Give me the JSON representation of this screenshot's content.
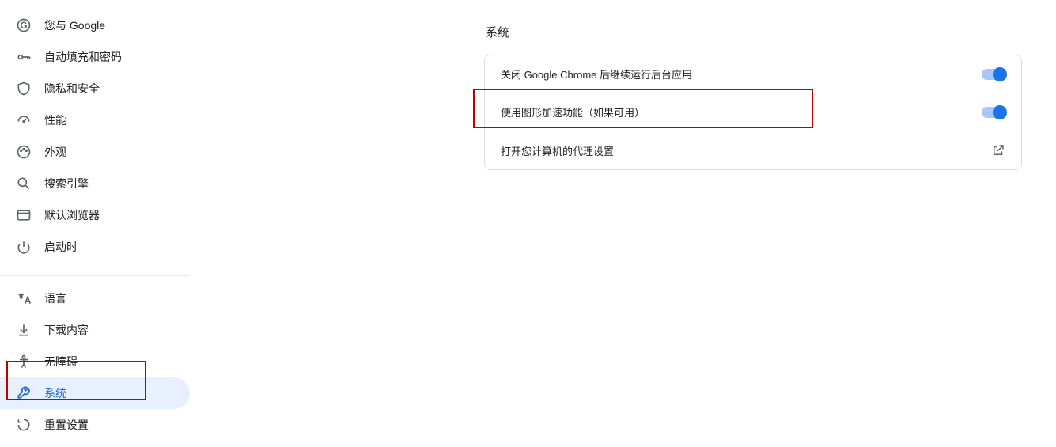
{
  "sidebar": {
    "group1": [
      {
        "label": "您与 Google",
        "icon": "google"
      },
      {
        "label": "自动填充和密码",
        "icon": "key"
      },
      {
        "label": "隐私和安全",
        "icon": "shield"
      },
      {
        "label": "性能",
        "icon": "speed"
      },
      {
        "label": "外观",
        "icon": "palette"
      },
      {
        "label": "搜索引擎",
        "icon": "search"
      },
      {
        "label": "默认浏览器",
        "icon": "browser"
      },
      {
        "label": "启动时",
        "icon": "power"
      }
    ],
    "group2": [
      {
        "label": "语言",
        "icon": "translate"
      },
      {
        "label": "下载内容",
        "icon": "download"
      },
      {
        "label": "无障碍",
        "icon": "accessibility"
      },
      {
        "label": "系统",
        "icon": "wrench",
        "active": true
      },
      {
        "label": "重置设置",
        "icon": "reset"
      }
    ]
  },
  "main": {
    "title": "系统",
    "rows": [
      {
        "label": "关闭 Google Chrome 后继续运行后台应用",
        "type": "toggle",
        "on": true
      },
      {
        "label": "使用图形加速功能（如果可用）",
        "type": "toggle",
        "on": true
      },
      {
        "label": "打开您计算机的代理设置",
        "type": "external"
      }
    ]
  }
}
